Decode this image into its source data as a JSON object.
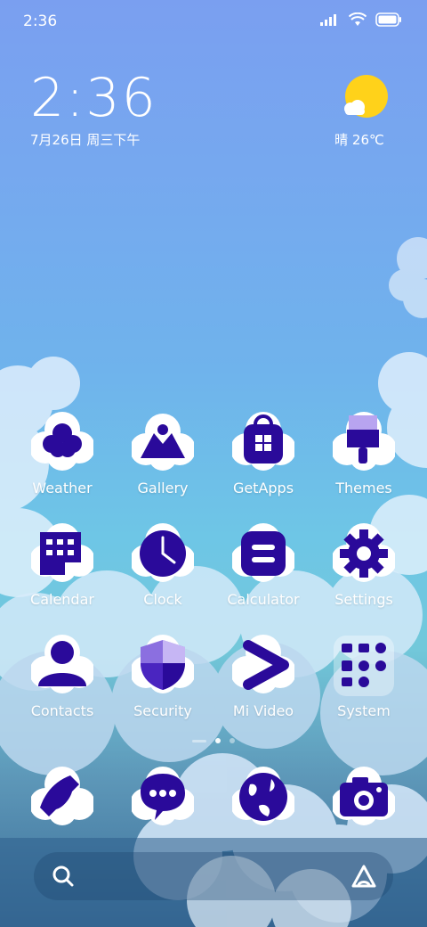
{
  "status_bar": {
    "time": "2:36",
    "icons": [
      "signal-icon",
      "wifi-icon",
      "battery-icon"
    ]
  },
  "clock_widget": {
    "time": "2:36",
    "date": "7月26日 周三下午"
  },
  "weather_widget": {
    "condition_icon": "sun-cloud-icon",
    "text": "晴 26℃"
  },
  "apps": [
    {
      "label": "Weather",
      "icon": "weather-cloud-icon"
    },
    {
      "label": "Gallery",
      "icon": "gallery-icon"
    },
    {
      "label": "GetApps",
      "icon": "getapps-icon"
    },
    {
      "label": "Themes",
      "icon": "themes-brush-icon"
    },
    {
      "label": "Calendar",
      "icon": "calendar-icon"
    },
    {
      "label": "Clock",
      "icon": "clock-icon"
    },
    {
      "label": "Calculator",
      "icon": "calculator-icon"
    },
    {
      "label": "Settings",
      "icon": "gear-icon"
    },
    {
      "label": "Contacts",
      "icon": "contacts-icon"
    },
    {
      "label": "Security",
      "icon": "shield-icon"
    },
    {
      "label": "Mi Video",
      "icon": "play-arrow-icon"
    },
    {
      "label": "System",
      "icon": "folder-icon"
    }
  ],
  "dock": [
    {
      "icon": "phone-icon"
    },
    {
      "icon": "messages-icon"
    },
    {
      "icon": "browser-globe-icon"
    },
    {
      "icon": "camera-icon"
    }
  ],
  "page_indicator": {
    "pages": 2,
    "current": 1
  },
  "search_bar": {
    "left_icon": "search-icon",
    "right_icon": "assistant-icon"
  },
  "colors": {
    "icon_fill": "#2a0a9a",
    "cloud": "#ffffff",
    "sun": "#ffd21a"
  }
}
